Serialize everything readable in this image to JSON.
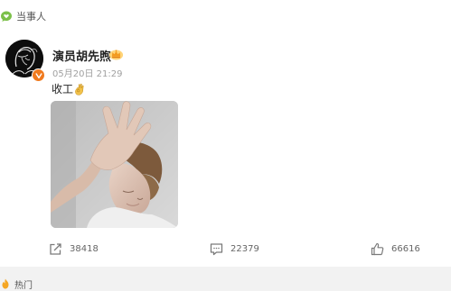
{
  "section": {
    "label": "当事人",
    "icon": "heart-chat-icon",
    "icon_color": "#7cc04a"
  },
  "post": {
    "author": {
      "name": "演员胡先煦",
      "avatar": "avatar",
      "verified_color": "#f07a1e",
      "badge": "crown-badge-icon"
    },
    "time": "05月20日 21:29",
    "text": "收工",
    "emoji": "ok-hand-emoji",
    "image": "selfie-hand-over-face-photo"
  },
  "actions": {
    "repost": {
      "icon": "repost-icon",
      "count": "38418"
    },
    "comment": {
      "icon": "comment-icon",
      "count": "22379"
    },
    "like": {
      "icon": "thumbs-up-icon",
      "count": "66616"
    }
  },
  "next_section": {
    "label": "热门",
    "icon": "flame-icon",
    "icon_color": "#f5a623"
  },
  "colors": {
    "background": "#f2f2f2",
    "card": "#ffffff",
    "text": "#333333",
    "muted": "#a0a0a0",
    "accent_orange": "#f07a1e"
  }
}
